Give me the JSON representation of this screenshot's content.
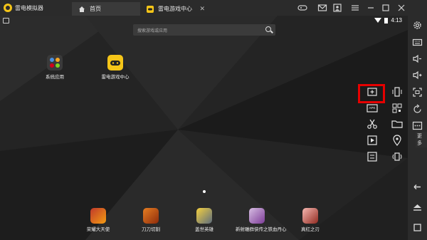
{
  "window": {
    "title": "雷电模拟器",
    "tabs": [
      {
        "label": "首页",
        "icon": "home-icon"
      },
      {
        "label": "雷电游戏中心",
        "icon": "gamepad-icon"
      }
    ],
    "toolbar_icons": [
      "gamepad-icon",
      "mail-icon",
      "user-icon",
      "menu-icon",
      "minimize-icon",
      "maximize-icon",
      "close-icon"
    ]
  },
  "status": {
    "time": "4:13"
  },
  "search": {
    "placeholder": "搜索游戏或应用"
  },
  "desktop_apps": [
    {
      "label": "系统应用",
      "icon": "system-apps-icon"
    },
    {
      "label": "雷电游戏中心",
      "icon": "game-center-icon"
    }
  ],
  "dock_apps": [
    {
      "label": "荣耀大天使",
      "icon": "game-icon"
    },
    {
      "label": "刀刀切割",
      "icon": "game-icon"
    },
    {
      "label": "盖世英雄",
      "icon": "game-icon"
    },
    {
      "label": "新射雕群侠传之铁血丹心",
      "icon": "game-icon"
    },
    {
      "label": "真红之刃",
      "icon": "game-icon"
    }
  ],
  "more_tools": {
    "items": [
      "multi-window-add-icon",
      "shake-icon",
      "apk-install-icon",
      "qr-code-icon",
      "scissors-icon",
      "folder-icon",
      "video-record-icon",
      "location-icon",
      "sync-icon",
      "operation-record-icon"
    ],
    "apk_label": "APK",
    "highlighted": "apk-install-icon"
  },
  "sidebar": {
    "icons": [
      "settings-icon",
      "keyboard-icon",
      "volume-down-icon",
      "volume-up-icon",
      "screenshot-icon",
      "rotate-icon",
      "more-icon",
      "back-icon",
      "home-icon",
      "recent-apps-icon"
    ],
    "tooltip": "更多"
  },
  "colors": {
    "titlebar": "#2b2b2b",
    "accent_yellow": "#f5c518",
    "highlight_red": "#e60000"
  }
}
